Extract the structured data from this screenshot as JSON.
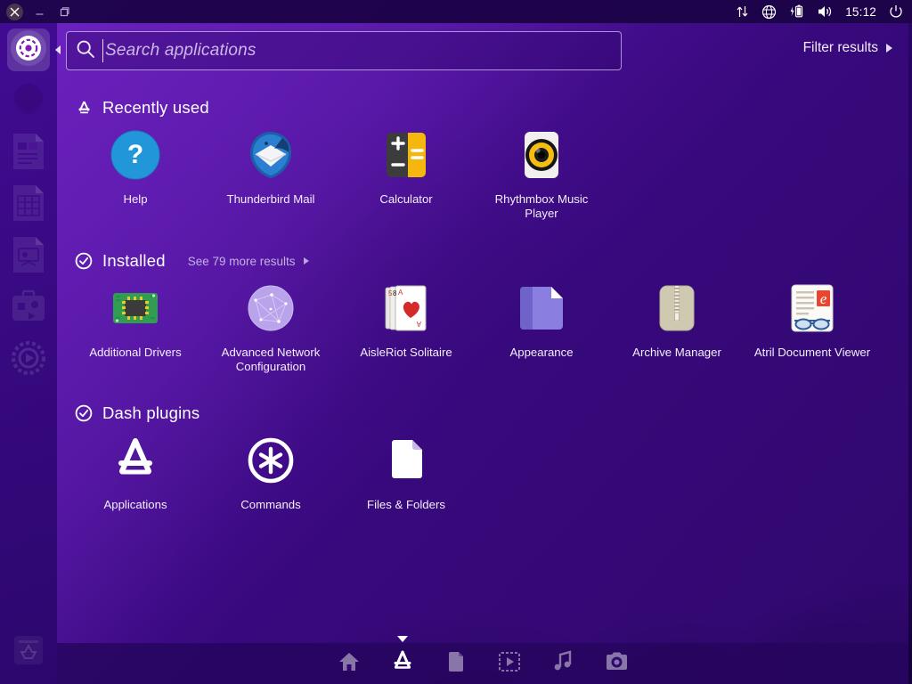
{
  "window_controls": [
    {
      "name": "close",
      "icon": "close-icon"
    },
    {
      "name": "minimize",
      "icon": "minimize-icon"
    },
    {
      "name": "maximize",
      "icon": "maximize-icon"
    }
  ],
  "tray": {
    "icons": [
      "network-activity-icon",
      "globe-icon",
      "battery-charging-icon",
      "volume-icon"
    ],
    "clock": "15:12",
    "power_icon": "power-icon"
  },
  "launcher": {
    "items": [
      {
        "label": "Ubuntu Dash Home",
        "icon": "ubuntu-logo-icon",
        "active": true
      },
      {
        "label": "Firefox Web Browser",
        "icon": "firefox-icon",
        "active": false
      },
      {
        "label": "LibreOffice Writer",
        "icon": "libreoffice-writer-icon",
        "active": false
      },
      {
        "label": "LibreOffice Calc",
        "icon": "libreoffice-calc-icon",
        "active": false
      },
      {
        "label": "LibreOffice Impress",
        "icon": "libreoffice-impress-icon",
        "active": false
      },
      {
        "label": "Ubuntu Software",
        "icon": "software-center-icon",
        "active": false
      },
      {
        "label": "System Settings",
        "icon": "system-settings-icon",
        "active": false
      }
    ],
    "trash": {
      "label": "Trash",
      "icon": "trash-icon"
    }
  },
  "search": {
    "placeholder": "Search applications",
    "value": "",
    "icon": "search-icon"
  },
  "filter": {
    "label": "Filter results",
    "icon": "chevron-right-icon"
  },
  "sections": [
    {
      "id": "recently-used",
      "title": "Recently used",
      "icon": "applications-lens-icon",
      "more": null,
      "apps": [
        {
          "label": "Help",
          "icon": "help-icon"
        },
        {
          "label": "Thunderbird Mail",
          "icon": "thunderbird-icon"
        },
        {
          "label": "Calculator",
          "icon": "calculator-icon"
        },
        {
          "label": "Rhythmbox Music Player",
          "icon": "rhythmbox-icon"
        }
      ]
    },
    {
      "id": "installed",
      "title": "Installed",
      "icon": "check-circle-icon",
      "more": {
        "label": "See 79 more results",
        "icon": "chevron-right-icon"
      },
      "apps": [
        {
          "label": "Additional Drivers",
          "icon": "additional-drivers-icon"
        },
        {
          "label": "Advanced Network Configuration",
          "icon": "network-config-icon"
        },
        {
          "label": "AisleRiot Solitaire",
          "icon": "solitaire-icon"
        },
        {
          "label": "Appearance",
          "icon": "appearance-icon"
        },
        {
          "label": "Archive Manager",
          "icon": "archive-manager-icon"
        },
        {
          "label": "Atril Document Viewer",
          "icon": "atril-icon"
        }
      ]
    },
    {
      "id": "dash-plugins",
      "title": "Dash plugins",
      "icon": "check-circle-icon",
      "more": null,
      "apps": [
        {
          "label": "Applications",
          "icon": "applications-lens-icon"
        },
        {
          "label": "Commands",
          "icon": "commands-icon"
        },
        {
          "label": "Files & Folders",
          "icon": "files-folders-icon"
        }
      ]
    }
  ],
  "dash_bar": {
    "lenses": [
      {
        "label": "Home",
        "icon": "home-lens-icon",
        "active": false
      },
      {
        "label": "Applications",
        "icon": "applications-lens-icon",
        "active": true
      },
      {
        "label": "Files",
        "icon": "files-lens-icon",
        "active": false
      },
      {
        "label": "Video",
        "icon": "video-lens-icon",
        "active": false
      },
      {
        "label": "Music",
        "icon": "music-lens-icon",
        "active": false
      },
      {
        "label": "Photos",
        "icon": "photos-lens-icon",
        "active": false
      }
    ]
  },
  "colors": {
    "desktop_purple": "#2b0670",
    "dash_overlay": "#6c14c8",
    "accent_text": "#ffffff",
    "muted_text": "#c3b0e2"
  }
}
